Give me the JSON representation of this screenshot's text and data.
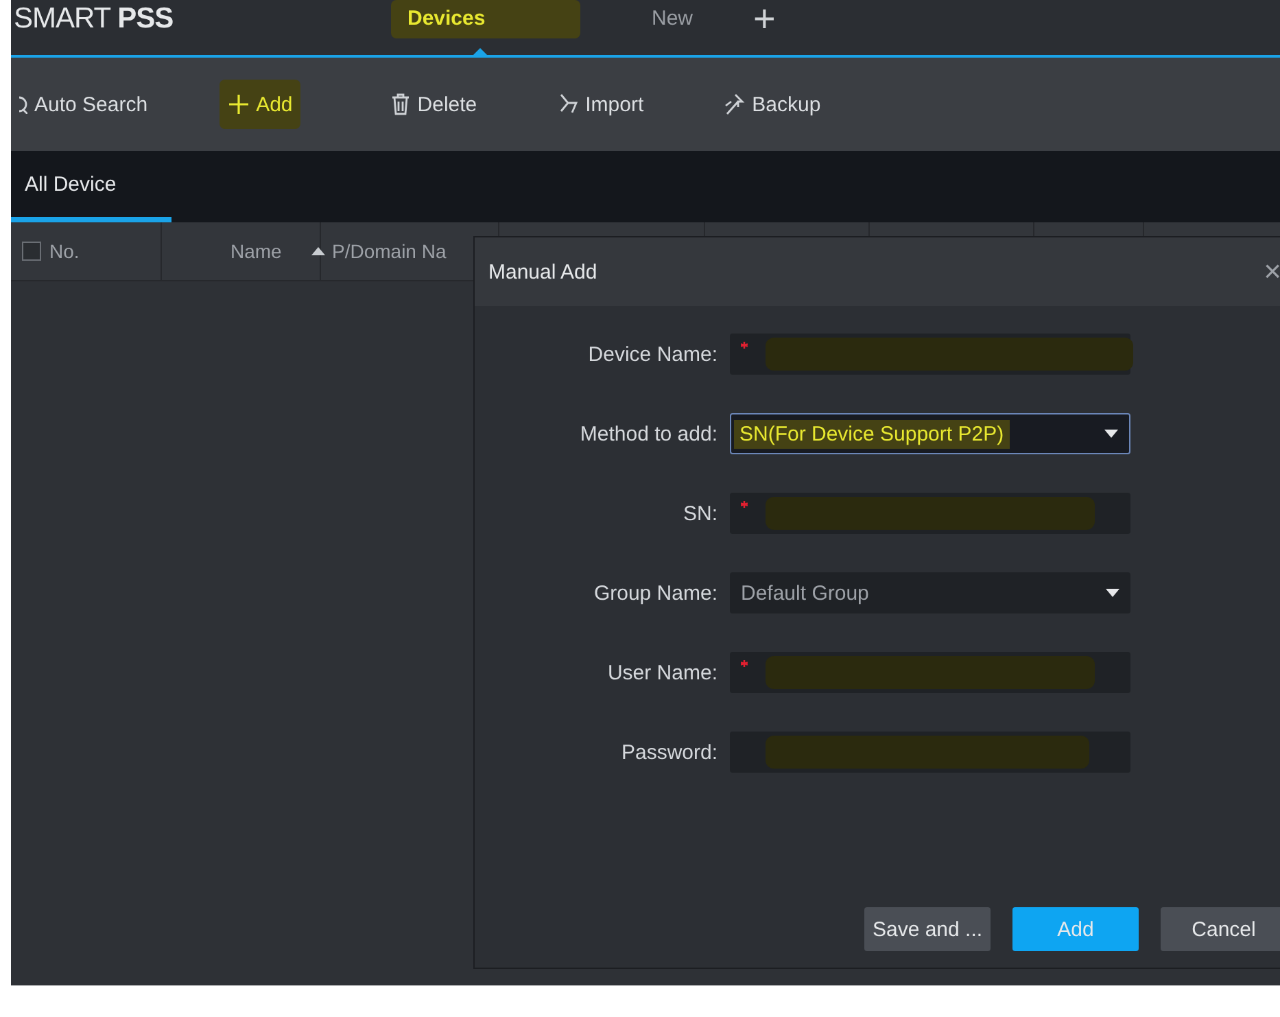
{
  "app": {
    "logo": "SMART **PSS**"
  },
  "tabs": [
    {
      "label": "Devices",
      "selected": true,
      "highlighted": true
    },
    {
      "label": "New",
      "selected": false,
      "highlighted": false
    },
    {
      "label": "+",
      "selected": false,
      "highlighted": false
    }
  ],
  "toolbar": [
    {
      "label": "Auto Search",
      "kind": "search",
      "highlighted": false
    },
    {
      "label": "Add",
      "kind": "add",
      "highlighted": true
    },
    {
      "label": "Delete",
      "kind": "delete",
      "highlighted": false
    },
    {
      "label": "Import",
      "kind": "import",
      "highlighted": false
    },
    {
      "label": "Backup",
      "kind": "backup",
      "highlighted": false
    }
  ],
  "device_tabs": [
    {
      "label": "All Device",
      "selected": true
    }
  ],
  "table": {
    "select_all_checked": false,
    "columns": [
      {
        "label": "No.",
        "sorted": false
      },
      {
        "label": "Name",
        "sorted": true
      },
      {
        "label": "P/Domain Na",
        "sorted": false
      }
    ]
  },
  "dialog": {
    "title": "Manual Add",
    "close": "×",
    "fields": [
      {
        "label": "Device Name:",
        "kind": "text",
        "required": true,
        "redacted": true,
        "focused": false
      },
      {
        "label": "Method to add:",
        "kind": "select",
        "value": "SN(For Device Support P2P)",
        "highlighted": true,
        "focused": true
      },
      {
        "label": "SN:",
        "kind": "text",
        "required": true,
        "redacted": true,
        "focused": false
      },
      {
        "label": "Group Name:",
        "kind": "select",
        "value": "Default Group",
        "highlighted": false,
        "focused": false
      },
      {
        "label": "User Name:",
        "kind": "text",
        "required": true,
        "redacted": true,
        "focused": false
      },
      {
        "label": "Password:",
        "kind": "text",
        "required": false,
        "redacted": true,
        "focused": false
      }
    ],
    "buttons": [
      {
        "label": "Save and ...",
        "kind": "secondary"
      },
      {
        "label": "Add",
        "kind": "primary"
      },
      {
        "label": "Cancel",
        "kind": "secondary"
      }
    ]
  }
}
